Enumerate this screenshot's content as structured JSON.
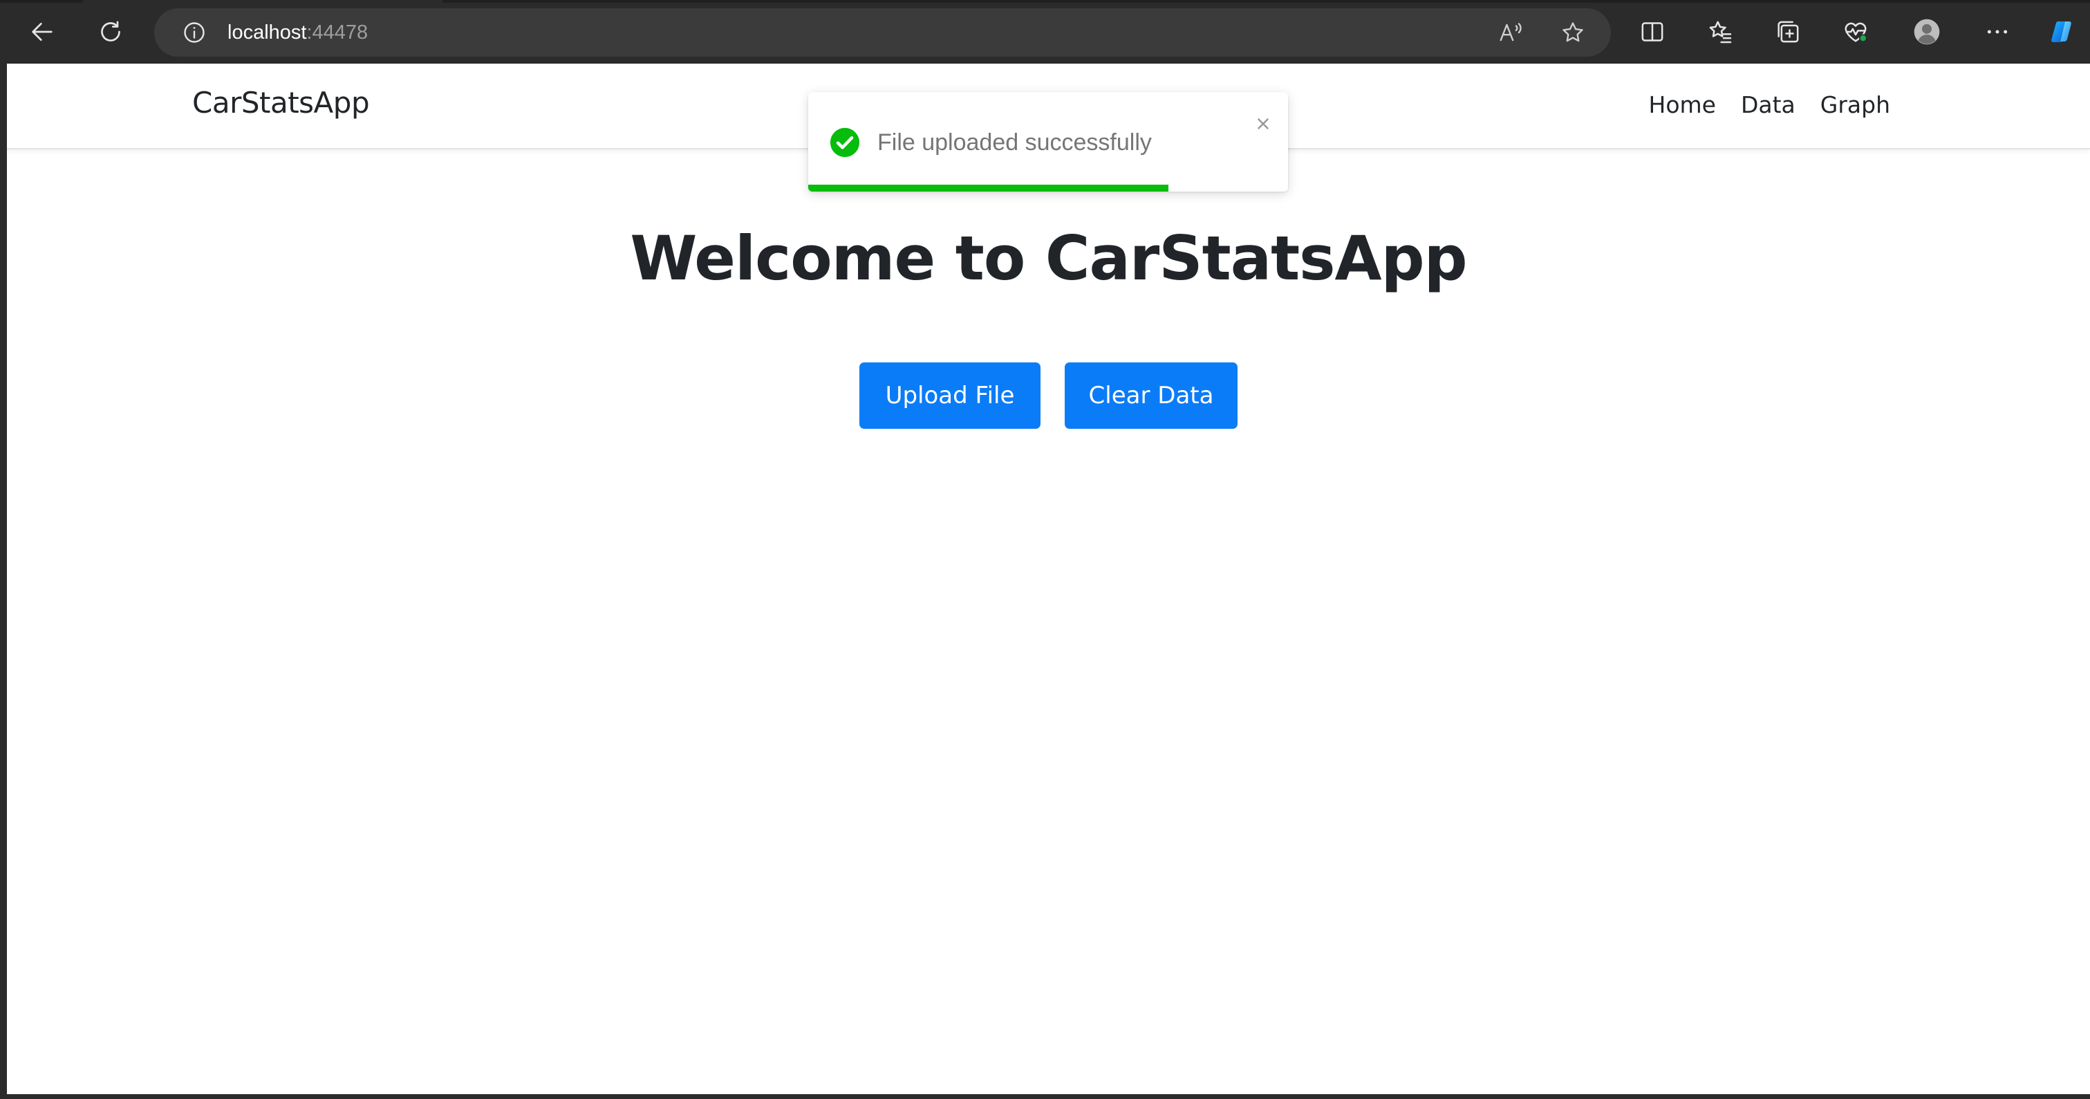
{
  "browser": {
    "address": {
      "host": "localhost",
      "port": ":44478"
    }
  },
  "app": {
    "brand": "CarStatsApp",
    "nav": [
      {
        "label": "Home"
      },
      {
        "label": "Data"
      },
      {
        "label": "Graph"
      }
    ]
  },
  "main": {
    "title": "Welcome to CarStatsApp",
    "upload_button": "Upload File",
    "clear_button": "Clear Data"
  },
  "toast": {
    "message": "File uploaded successfully",
    "status": "success",
    "progress_fraction": 0.75,
    "color": "#07bc0c"
  },
  "colors": {
    "primary_button": "#0b7cf8",
    "chrome_bg": "#2b2b2b",
    "address_bar_bg": "#3b3b3b"
  }
}
